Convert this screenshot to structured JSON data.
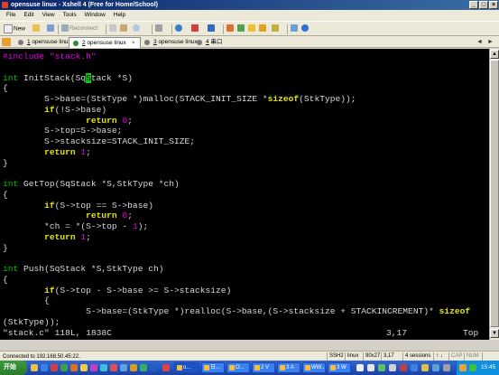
{
  "window": {
    "title": "opensuse linux - Xshell 4 (Free for Home/School)"
  },
  "menu": [
    "File",
    "Edit",
    "View",
    "Tools",
    "Window",
    "Help"
  ],
  "toolbar": {
    "new_label": "New",
    "reconnect_label": "Reconnect"
  },
  "tabs": [
    {
      "number": "1",
      "label": "opensuse linux",
      "active": false
    },
    {
      "number": "2",
      "label": "opensuse linux",
      "active": true
    },
    {
      "number": "3",
      "label": "opensuse linux",
      "active": false
    },
    {
      "number": "4",
      "label": "串口",
      "active": false
    }
  ],
  "terminal": {
    "lines": [
      [
        [
          "pp",
          "#include "
        ],
        [
          "st",
          "\"stack.h\""
        ]
      ],
      [],
      [
        [
          "ty",
          "int"
        ],
        [
          "",
          " InitStack(Sq"
        ],
        [
          "cursor",
          "S"
        ],
        [
          "",
          "tack *S)"
        ]
      ],
      [
        [
          "",
          "{"
        ]
      ],
      [
        [
          "",
          "        S->base=(StkType *)malloc(STACK_INIT_SIZE *"
        ],
        [
          "kw",
          "sizeof"
        ],
        [
          "",
          "(StkType));"
        ]
      ],
      [
        [
          "",
          "        "
        ],
        [
          "kw",
          "if"
        ],
        [
          "",
          "(!S->base)"
        ]
      ],
      [
        [
          "",
          "                "
        ],
        [
          "kw",
          "return"
        ],
        [
          "",
          " "
        ],
        [
          "nm",
          "0"
        ],
        [
          "",
          ";"
        ]
      ],
      [
        [
          "",
          "        S->top=S->base;"
        ]
      ],
      [
        [
          "",
          "        S->stacksize=STACK_INIT_SIZE;"
        ]
      ],
      [
        [
          "",
          "        "
        ],
        [
          "kw",
          "return"
        ],
        [
          "",
          " "
        ],
        [
          "nm",
          "1"
        ],
        [
          "",
          ";"
        ]
      ],
      [
        [
          "",
          "}"
        ]
      ],
      [],
      [
        [
          "ty",
          "int"
        ],
        [
          "",
          " GetTop(SqStack *S,StkType *ch)"
        ]
      ],
      [
        [
          "",
          "{"
        ]
      ],
      [
        [
          "",
          "        "
        ],
        [
          "kw",
          "if"
        ],
        [
          "",
          "(S->top == S->base)"
        ]
      ],
      [
        [
          "",
          "                "
        ],
        [
          "kw",
          "return"
        ],
        [
          "",
          " "
        ],
        [
          "nm",
          "0"
        ],
        [
          "",
          ";"
        ]
      ],
      [
        [
          "",
          "        *ch = *(S->top - "
        ],
        [
          "nm",
          "1"
        ],
        [
          "",
          ");"
        ]
      ],
      [
        [
          "",
          "        "
        ],
        [
          "kw",
          "return"
        ],
        [
          "",
          " "
        ],
        [
          "nm",
          "1"
        ],
        [
          "",
          ";"
        ]
      ],
      [
        [
          "",
          "}"
        ]
      ],
      [],
      [
        [
          "ty",
          "int"
        ],
        [
          "",
          " Push(SqStack *S,StkType ch)"
        ]
      ],
      [
        [
          "",
          "{"
        ]
      ],
      [
        [
          "",
          "        "
        ],
        [
          "kw",
          "if"
        ],
        [
          "",
          "(S->top - S->base >= S->stacksize)"
        ]
      ],
      [
        [
          "",
          "        {"
        ]
      ],
      [
        [
          "",
          "                S->base=(StkType *)realloc(S->base,(S->stacksize + STACKINCREMENT)* "
        ],
        [
          "kw",
          "sizeof"
        ]
      ],
      [
        [
          "",
          "(StkType));"
        ]
      ]
    ],
    "status_file": "\"stack.c\" 118L, 1838C",
    "status_pos": "3,17",
    "status_scroll": "Top"
  },
  "statusbar": {
    "connection": "Connected to 192.168.50.45:22.",
    "protocol": "SSH2",
    "term": "linux",
    "size": "90x27",
    "cursor": "3,17",
    "sessions": "4 sessions",
    "cap": "CAP",
    "num": "NUM"
  },
  "taskbar": {
    "start_label": "开始",
    "tasks": [
      "o...",
      "日...",
      "O...",
      "2 V",
      "3 A",
      "WW...",
      "3 W"
    ],
    "clock": "15:45"
  }
}
